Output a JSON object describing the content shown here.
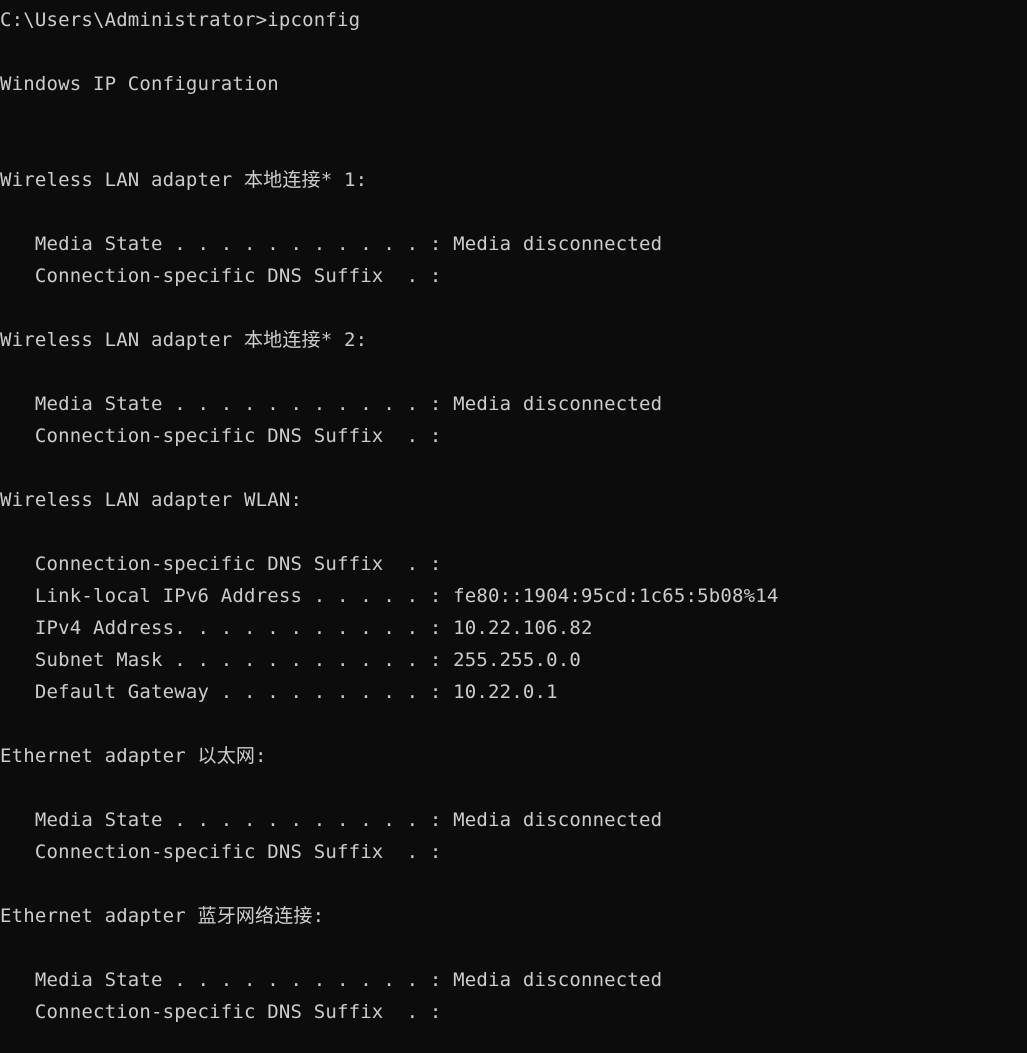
{
  "terminal": {
    "shell": "cmd.exe",
    "background_color": "#0c0c0c",
    "foreground_color": "#cccccc",
    "prompt": "C:\\Users\\Administrator>",
    "command": "ipconfig",
    "prompt_line": "C:\\Users\\Administrator>ipconfig",
    "output_title": "Windows IP Configuration",
    "lines": [
      "C:\\Users\\Administrator>ipconfig",
      "",
      "Windows IP Configuration",
      "",
      "",
      "Wireless LAN adapter 本地连接* 1:",
      "",
      "   Media State . . . . . . . . . . . : Media disconnected",
      "   Connection-specific DNS Suffix  . :",
      "",
      "Wireless LAN adapter 本地连接* 2:",
      "",
      "   Media State . . . . . . . . . . . : Media disconnected",
      "   Connection-specific DNS Suffix  . :",
      "",
      "Wireless LAN adapter WLAN:",
      "",
      "   Connection-specific DNS Suffix  . :",
      "   Link-local IPv6 Address . . . . . : fe80::1904:95cd:1c65:5b08%14",
      "   IPv4 Address. . . . . . . . . . . : 10.22.106.82",
      "   Subnet Mask . . . . . . . . . . . : 255.255.0.0",
      "   Default Gateway . . . . . . . . . : 10.22.0.1",
      "",
      "Ethernet adapter 以太网:",
      "",
      "   Media State . . . . . . . . . . . : Media disconnected",
      "   Connection-specific DNS Suffix  . :",
      "",
      "Ethernet adapter 蓝牙网络连接:",
      "",
      "   Media State . . . . . . . . . . . : Media disconnected",
      "   Connection-specific DNS Suffix  . :"
    ],
    "adapters": [
      {
        "header": "Wireless LAN adapter 本地连接* 1:",
        "type": "Wireless LAN adapter",
        "name": "本地连接* 1",
        "media_state_label": "Media State",
        "media_state_value": "Media disconnected",
        "dns_suffix_label": "Connection-specific DNS Suffix",
        "dns_suffix_value": ""
      },
      {
        "header": "Wireless LAN adapter 本地连接* 2:",
        "type": "Wireless LAN adapter",
        "name": "本地连接* 2",
        "media_state_label": "Media State",
        "media_state_value": "Media disconnected",
        "dns_suffix_label": "Connection-specific DNS Suffix",
        "dns_suffix_value": ""
      },
      {
        "header": "Wireless LAN adapter WLAN:",
        "type": "Wireless LAN adapter",
        "name": "WLAN",
        "dns_suffix_label": "Connection-specific DNS Suffix",
        "dns_suffix_value": "",
        "ipv6_link_local_label": "Link-local IPv6 Address",
        "ipv6_link_local_value": "fe80::1904:95cd:1c65:5b08%14",
        "ipv4_label": "IPv4 Address",
        "ipv4_value": "10.22.106.82",
        "subnet_mask_label": "Subnet Mask",
        "subnet_mask_value": "255.255.0.0",
        "default_gateway_label": "Default Gateway",
        "default_gateway_value": "10.22.0.1"
      },
      {
        "header": "Ethernet adapter 以太网:",
        "type": "Ethernet adapter",
        "name": "以太网",
        "media_state_label": "Media State",
        "media_state_value": "Media disconnected",
        "dns_suffix_label": "Connection-specific DNS Suffix",
        "dns_suffix_value": ""
      },
      {
        "header": "Ethernet adapter 蓝牙网络连接:",
        "type": "Ethernet adapter",
        "name": "蓝牙网络连接",
        "media_state_label": "Media State",
        "media_state_value": "Media disconnected",
        "dns_suffix_label": "Connection-specific DNS Suffix",
        "dns_suffix_value": ""
      }
    ]
  }
}
